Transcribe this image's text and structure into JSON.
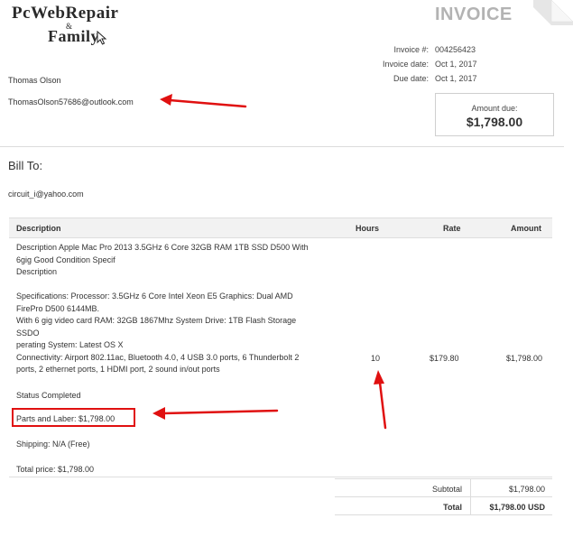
{
  "logo": {
    "line1": "PcWebRepair",
    "ampersand": "&",
    "line2": "Family"
  },
  "invoice": {
    "title": "INVOICE",
    "meta_labels": [
      "Invoice #:",
      "Invoice date:",
      "Due date:"
    ],
    "meta_values": [
      "004256423",
      "Oct 1, 2017",
      "Oct 1, 2017"
    ],
    "amount_due_label": "Amount due:",
    "amount_due_value": "$1,798.00"
  },
  "from": {
    "name": "Thomas Olson",
    "email": "ThomasOlson57686@outlook.com"
  },
  "bill_to": {
    "heading": "Bill To:",
    "email": "circuit_i@yahoo.com"
  },
  "items": {
    "headers": [
      "Description",
      "Hours",
      "Rate",
      "Amount"
    ],
    "description_lines": [
      "Description Apple Mac Pro 2013 3.5GHz 6 Core 32GB RAM 1TB SSD D500 With",
      "6gig Good Condition Specif",
      "Description",
      "",
      "Specifications: Processor: 3.5GHz 6 Core Intel Xeon E5 Graphics: Dual AMD",
      "FirePro D500 6144MB.",
      "With 6 gig video card RAM: 32GB 1867Mhz System Drive: 1TB Flash Storage",
      "SSDO",
      "perating System: Latest OS X",
      "Connectivity: Airport 802.11ac, Bluetooth 4.0, 4 USB 3.0 ports, 6 Thunderbolt 2",
      "ports, 2 ethernet ports, 1 HDMI port, 2 sound in/out ports"
    ],
    "hours": "10",
    "rate": "$179.80",
    "amount": "$1,798.00",
    "status": "Status Completed",
    "parts_and_labor": "Parts and Laber: $1,798.00",
    "shipping": "Shipping: N/A (Free)",
    "total_price": "Total price: $1,798.00"
  },
  "totals": {
    "subtotal_label": "Subtotal",
    "subtotal_value": "$1,798.00",
    "total_label": "Total",
    "total_value": "$1,798.00 USD"
  },
  "colors": {
    "annotation_red": "#e01010",
    "header_gray": "#b3b3b3"
  }
}
